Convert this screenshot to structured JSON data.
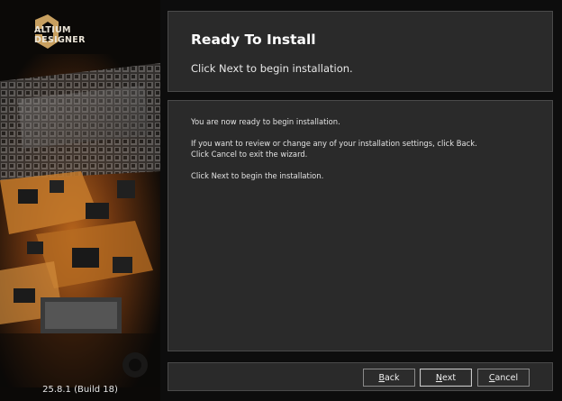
{
  "brand": {
    "line1": "ALTIUM",
    "line2": "DESIGNER",
    "version": "25.8.1 (Build 18)"
  },
  "header": {
    "title": "Ready To Install",
    "subtitle": "Click Next to begin installation."
  },
  "body": {
    "line1": "You are now ready to begin installation.",
    "line2": "If you want to review or change any of your installation settings, click Back.",
    "line3": "Click Cancel to exit the wizard.",
    "line4": "Click Next to begin the installation."
  },
  "buttons": {
    "back": {
      "mnemonic": "B",
      "rest": "ack"
    },
    "next": {
      "mnemonic": "N",
      "rest": "ext"
    },
    "cancel": {
      "mnemonic": "C",
      "rest": "ancel"
    }
  },
  "colors": {
    "accent": "#c8a060",
    "panel": "#2a2a2a",
    "background": "#0d0d0d"
  },
  "icons": {
    "logo": "altium-logo-icon"
  }
}
